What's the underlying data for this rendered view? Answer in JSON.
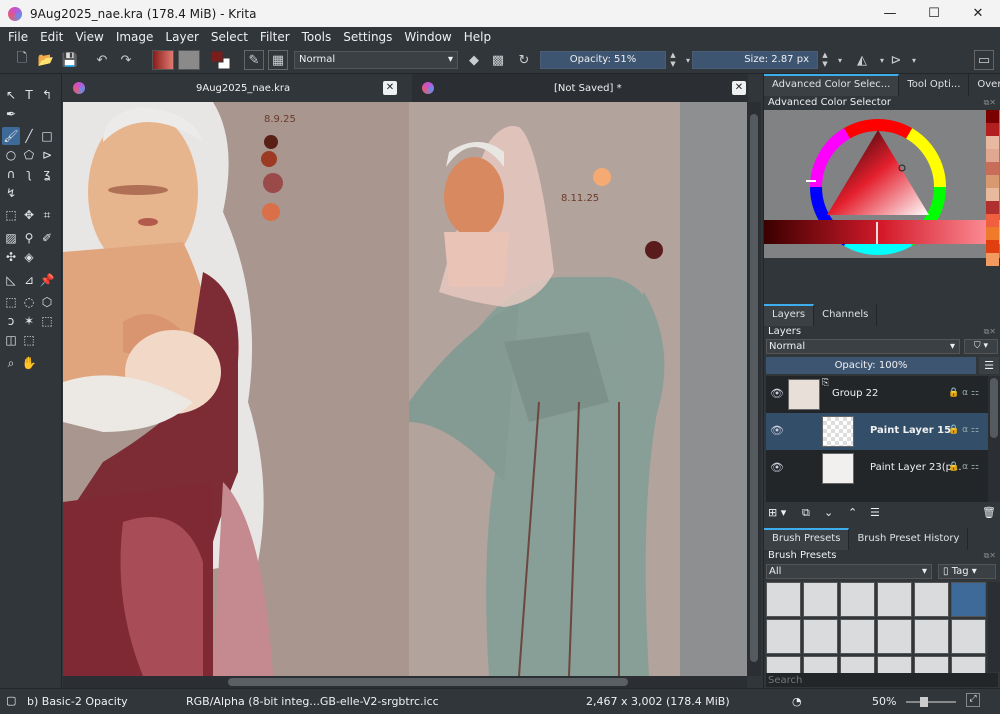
{
  "window": {
    "title": "9Aug2025_nae.kra (178.4 MiB)  - Krita",
    "minimize": "—",
    "maximize": "☐",
    "close": "✕"
  },
  "menu": [
    "File",
    "Edit",
    "View",
    "Image",
    "Layer",
    "Select",
    "Filter",
    "Tools",
    "Settings",
    "Window",
    "Help"
  ],
  "toolbar": {
    "blend_mode": "Normal",
    "opacity_label": "Opacity: 51%",
    "size_label": "Size: 2.87 px",
    "fg_color": "#7a1d1d",
    "bg_color": "#ffffff"
  },
  "tabs": [
    {
      "label": "9Aug2025_nae.kra",
      "close": "✕"
    },
    {
      "label": "[Not Saved]  *",
      "close": "✕"
    }
  ],
  "canvas": {
    "date_left": "8.9.25",
    "date_right": "8.11.25",
    "bg_left": "#a89890",
    "bg_right": "#b2a39c"
  },
  "dock": {
    "top_tabs": [
      "Advanced Color Selec...",
      "Tool Opti...",
      "Overvi..."
    ],
    "color_selector_title": "Advanced Color Selector",
    "layer_tabs": [
      "Layers",
      "Channels"
    ],
    "layers_title": "Layers",
    "layers_blend": "Normal",
    "layers_opacity": "Opacity:  100%",
    "layers": [
      {
        "name": "Group 22",
        "selected": false
      },
      {
        "name": "Paint Layer 15",
        "selected": true
      },
      {
        "name": "Paint Layer 23(p...",
        "selected": false
      }
    ],
    "brush_tabs": [
      "Brush Presets",
      "Brush Preset History"
    ],
    "brush_presets_title": "Brush Presets",
    "brush_filter": "All",
    "brush_tag": "Tag",
    "search_placeholder": "Search"
  },
  "status": {
    "brush": "b) Basic-2 Opacity",
    "color_space": "RGB/Alpha (8-bit integ...GB-elle-V2-srgbtrc.icc",
    "dimensions": "2,467 x 3,002 (178.4 MiB)",
    "zoom": "50%"
  },
  "palette": [
    "#7a0000",
    "#b11f1f",
    "#e8b8a0",
    "#e0a890",
    "#c86d5a",
    "#d89870",
    "#e9b99e",
    "#b03030",
    "#f06040",
    "#ef7a2b",
    "#e04010",
    "#f39a60"
  ]
}
